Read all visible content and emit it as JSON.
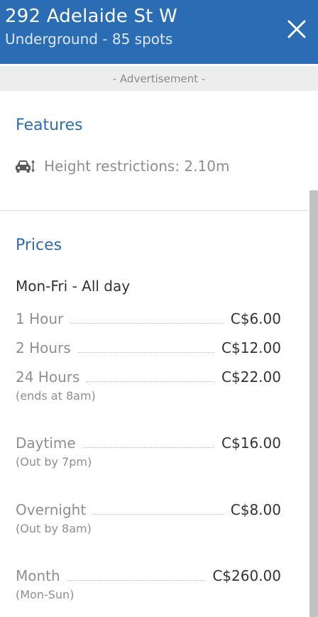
{
  "header": {
    "title": "292 Adelaide St W",
    "subtitle": "Underground - 85 spots",
    "close_icon": "close-icon"
  },
  "advertisement": {
    "label": "- Advertisement -"
  },
  "features": {
    "title": "Features",
    "items": [
      {
        "icon": "car-height-icon",
        "text": "Height restrictions: 2.10m"
      }
    ]
  },
  "prices": {
    "title": "Prices",
    "group_title": "Mon-Fri - All day",
    "rows": [
      {
        "label": "1 Hour",
        "value": "C$6.00",
        "note": ""
      },
      {
        "label": "2 Hours",
        "value": "C$12.00",
        "note": ""
      },
      {
        "label": "24 Hours",
        "value": "C$22.00",
        "note": "(ends at 8am)"
      },
      {
        "label": "Daytime",
        "value": "C$16.00",
        "note": "(Out by 7pm)"
      },
      {
        "label": "Overnight",
        "value": "C$8.00",
        "note": "(Out by 8am)"
      },
      {
        "label": "Month",
        "value": "C$260.00",
        "note": "(Mon-Sun)"
      }
    ]
  },
  "colors": {
    "brand": "#2a6db4",
    "ad_background": "#ededed",
    "muted_text": "#8f8f8f",
    "dark_text": "#333333"
  }
}
